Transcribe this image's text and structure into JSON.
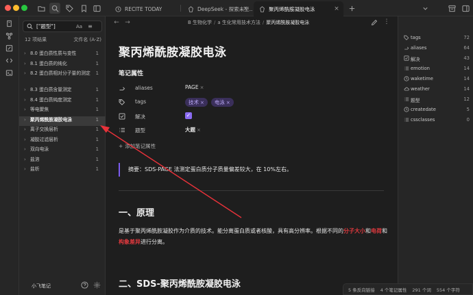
{
  "tabs": [
    {
      "label": "RECITE TODAY",
      "icon": "clock-icon"
    },
    {
      "label": "DeepSeek - 探索未至...",
      "icon": "obsidian-icon"
    },
    {
      "label": "聚丙烯酰胺凝胶电泳",
      "icon": "obsidian-icon"
    }
  ],
  "search": {
    "value": "[\"题型\"]",
    "case_label": "Aa"
  },
  "file_meta": {
    "count": "12 项结果",
    "sort": "文件名 (A-Z)"
  },
  "files": [
    {
      "label": "8.0 蛋白质性质与变性",
      "count": "1"
    },
    {
      "label": "8.1 蛋白质的纯化",
      "count": "1"
    },
    {
      "label": "8.2 蛋白质相对分子量的测定",
      "count": "1"
    },
    {
      "label": "8.3 蛋白质含量测定",
      "count": "1"
    },
    {
      "label": "8.4 蛋白质纯度测定",
      "count": "1"
    },
    {
      "label": "等电聚焦",
      "count": "1"
    },
    {
      "label": "聚丙烯酰胺凝胶电泳",
      "count": "1"
    },
    {
      "label": "离子交换层析",
      "count": "1"
    },
    {
      "label": "凝胶过滤层析",
      "count": "1"
    },
    {
      "label": "双向电泳",
      "count": "1"
    },
    {
      "label": "盐溶",
      "count": "1"
    },
    {
      "label": "盐析",
      "count": "1"
    }
  ],
  "vault_name": "小飞笔记",
  "breadcrumbs": [
    "B 生物化学",
    "a 生化常用技术方法",
    "聚丙烯酰胺凝胶电泳"
  ],
  "note": {
    "title": "聚丙烯酰胺凝胶电泳",
    "props_heading": "笔记属性",
    "aliases_key": "aliases",
    "aliases_val": "PAGE",
    "tags_key": "tags",
    "tag1": "技术",
    "tag2": "电泳",
    "solve_key": "解决",
    "type_key": "题型",
    "type_val": "大题",
    "add_prop": "添加笔记属性",
    "summary": "摘要：SDS-PAGE 法测定蛋白质分子质量偏差较大，在 10%左右。",
    "h1": "一、原理",
    "p1": "是基于聚丙烯酰胺凝胶作为介质的技术。能分离蛋白质或者核酸，具有高分辨率。根据不同的",
    "r1": "分子大小",
    "and1": "和",
    "r2": "电荷",
    "and2": "和",
    "r3": "构象差异",
    "p1_end": "进行分离。",
    "h2": "二、SDS-聚丙烯酰胺凝胶电泳"
  },
  "properties": [
    {
      "label": "tags",
      "count": "72",
      "icon": "tags-icon"
    },
    {
      "label": "aliases",
      "count": "64",
      "icon": "link-icon"
    },
    {
      "label": "解决",
      "count": "43",
      "icon": "checkbox-icon"
    },
    {
      "label": "emotion",
      "count": "14",
      "icon": "list-icon"
    },
    {
      "label": "waketime",
      "count": "14",
      "icon": "clock-icon"
    },
    {
      "label": "weather",
      "count": "14",
      "icon": "cloud-icon"
    },
    {
      "label": "题型",
      "count": "12",
      "icon": "list-icon"
    },
    {
      "label": "createdate",
      "count": "5",
      "icon": "clock-icon"
    },
    {
      "label": "cssclasses",
      "count": "0",
      "icon": "list-icon"
    }
  ],
  "status": {
    "backlinks": "5 条反向链接",
    "props": "4 个笔记属性",
    "words": "291 个词",
    "chars": "554 个字符"
  },
  "colors": {
    "accent": "#8a6bf2",
    "tag_bg": "#3a2f5a",
    "tag_fg": "#b9a7f5",
    "highlight_red": "#e0393e",
    "arrow": "#e8323a"
  }
}
